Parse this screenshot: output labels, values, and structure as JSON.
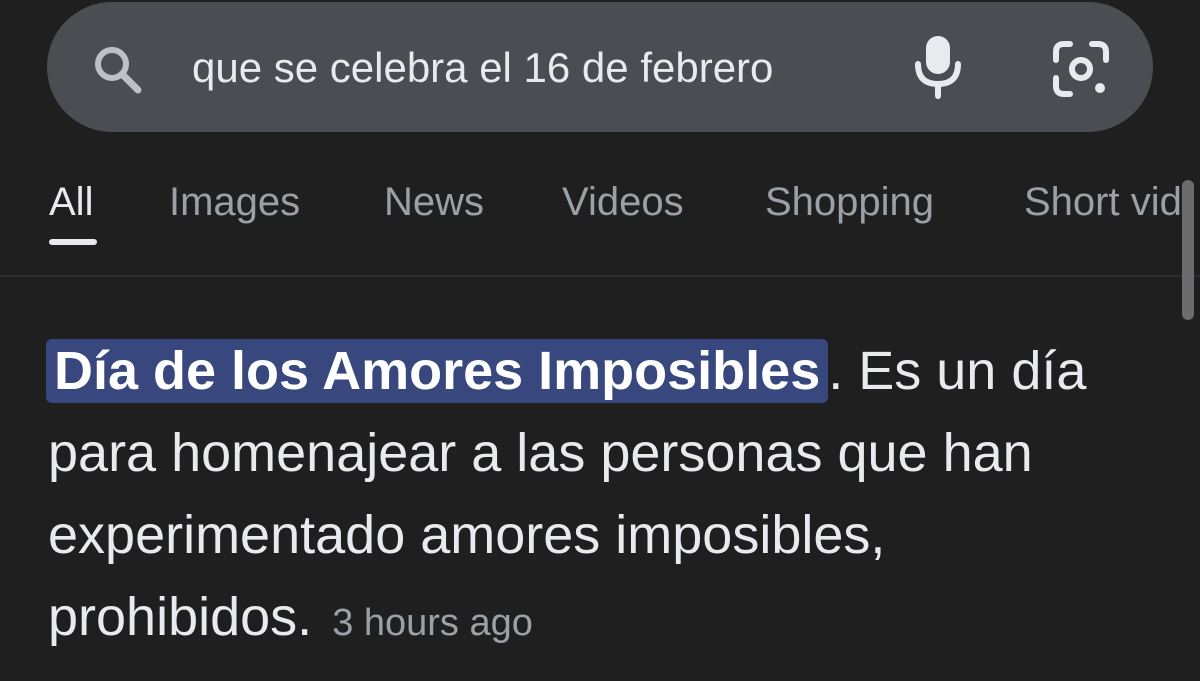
{
  "search": {
    "query": "que se celebra el 16 de febrero",
    "icons": {
      "search": "search-icon",
      "voice": "microphone-icon",
      "lens": "google-lens-icon"
    }
  },
  "tabs": [
    {
      "label": "All",
      "active": true
    },
    {
      "label": "Images",
      "active": false
    },
    {
      "label": "News",
      "active": false
    },
    {
      "label": "Videos",
      "active": false
    },
    {
      "label": "Shopping",
      "active": false
    },
    {
      "label": "Short vid",
      "active": false
    }
  ],
  "answer": {
    "highlight": "Día de los Amores Imposibles",
    "text": ". Es un día para homenajear a las personas que han experimentado amores imposibles, prohibidos.",
    "timestamp": "3 hours ago"
  },
  "colors": {
    "background": "#1f1f1f",
    "search_bar": "#4a4d51",
    "highlight": "#38487f",
    "text_primary": "#e8eaed",
    "text_secondary": "#9aa0a6"
  }
}
